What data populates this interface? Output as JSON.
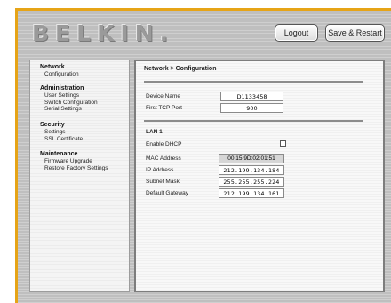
{
  "brand": {
    "logo_text": "BELKIN",
    "logo_dot": "."
  },
  "header": {
    "logout_label": "Logout",
    "save_restart_label": "Save & Restart"
  },
  "sidebar": {
    "sections": [
      {
        "title": "Network",
        "items": [
          "Configuration"
        ]
      },
      {
        "title": "Administration",
        "items": [
          "User Settings",
          "Switch Configuration",
          "Serial Settings"
        ]
      },
      {
        "title": "Security",
        "items": [
          "Settings",
          "SSL Certificate"
        ]
      },
      {
        "title": "Maintenance",
        "items": [
          "Firmware Upgrade",
          "Restore Factory Settings"
        ]
      }
    ]
  },
  "main": {
    "breadcrumb": "Network > Configuration",
    "device_name": {
      "label": "Device Name",
      "value": "D1133458"
    },
    "first_tcp_port": {
      "label": "First TCP Port",
      "value": "900"
    },
    "lan": {
      "title": "LAN 1",
      "enable_dhcp": {
        "label": "Enable DHCP",
        "checked": false
      },
      "mac_address": {
        "label": "MAC Address",
        "value": "00:15:9D:02:01:51"
      },
      "ip_address": {
        "label": "IP Address",
        "value": "212.199.134.184"
      },
      "subnet_mask": {
        "label": "Subnet Mask",
        "value": "255.255.255.224"
      },
      "default_gateway": {
        "label": "Default Gateway",
        "value": "212.199.134.161"
      }
    }
  },
  "colors": {
    "accent_border": "#e6a417",
    "panel_bg": "#bfbfbf"
  }
}
